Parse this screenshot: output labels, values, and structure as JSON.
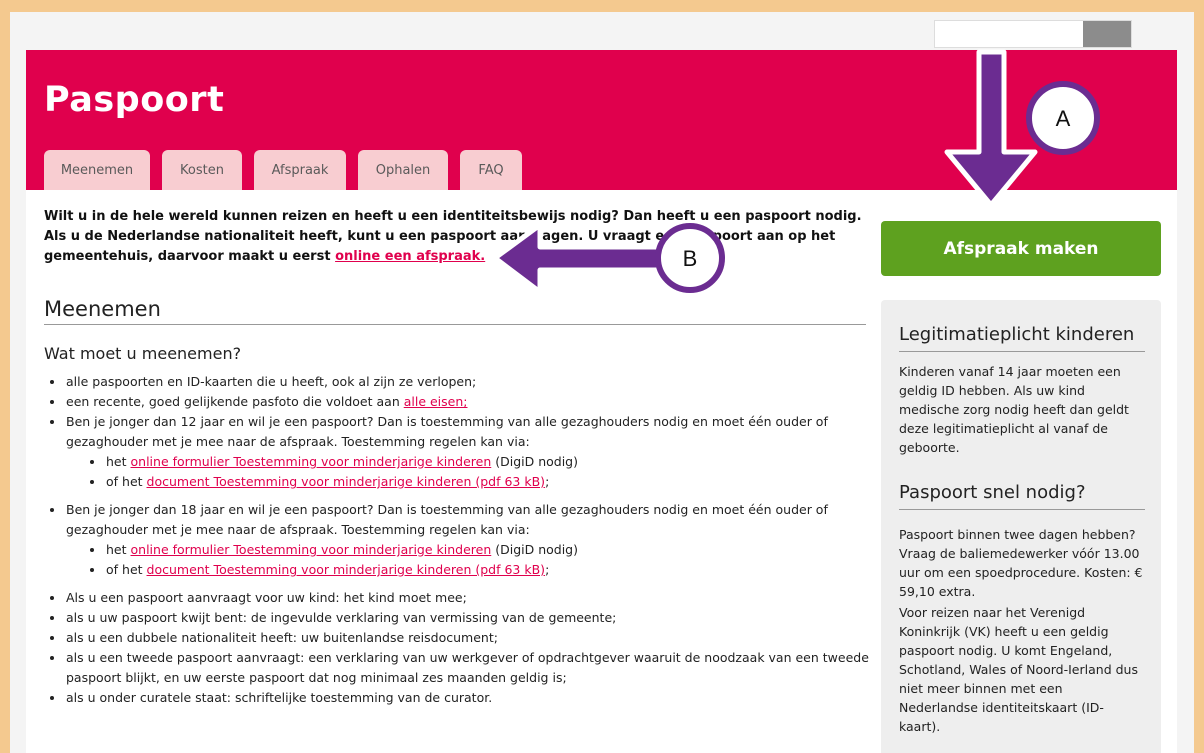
{
  "page": {
    "title": "Paspoort"
  },
  "tabs": [
    "Meenemen",
    "Kosten",
    "Afspraak",
    "Ophalen",
    "FAQ"
  ],
  "intro": {
    "line1": "Wilt u in de hele wereld kunnen reizen en heeft u een identiteitsbewijs nodig? Dan heeft u een paspoort nodig.",
    "line2": "Als u de Nederlandse nationaliteit heeft, kunt u een paspoort aanvragen. U vraagt een paspoort aan op het",
    "line3_prefix": "gemeentehuis, daarvoor maakt u eerst ",
    "line3_link": "online een afspraak."
  },
  "section": {
    "heading": "Meenemen",
    "subheading": "Wat moet u meenemen?",
    "items": {
      "i1": "alle paspoorten en ID-kaarten die u heeft, ook al zijn ze verlopen;",
      "i2_text": "een recente, goed gelijkende pasfoto die voldoet aan ",
      "i2_link": "alle eisen;",
      "i3": "Ben je jonger dan 12 jaar en wil je een paspoort? Dan is toestemming van alle gezaghouders nodig en moet één ouder of gezaghouder met je mee naar de afspraak. Toestemming regelen kan via:",
      "i3a_pre": "het ",
      "i3a_link": "online formulier Toestemming voor minderjarige kinderen",
      "i3a_post": " (DigiD nodig)",
      "i3b_pre": "of het ",
      "i3b_link": "document Toestemming voor minderjarige kinderen (pdf 63 kB)",
      "i3b_post": ";",
      "i4": "Ben je jonger dan 18 jaar en wil je een paspoort? Dan is toestemming van alle gezaghouders nodig en moet één ouder of gezaghouder met je mee naar de afspraak. Toestemming regelen kan via:",
      "i4a_pre": "het ",
      "i4a_link": "online formulier Toestemming voor minderjarige kinderen",
      "i4a_post": " (DigiD nodig)",
      "i4b_pre": "of het ",
      "i4b_link": "document Toestemming voor minderjarige kinderen (pdf 63 kB)",
      "i4b_post": ";",
      "i5": "Als u een paspoort aanvraagt voor uw kind: het kind moet mee;",
      "i6": "als u uw paspoort kwijt bent: de ingevulde verklaring van vermissing van de gemeente;",
      "i7": "als u een dubbele nationaliteit heeft: uw buitenlandse reisdocument;",
      "i8": "als u een tweede paspoort aanvraagt: een verklaring van uw werkgever of opdrachtgever waaruit de noodzaak van een tweede paspoort blijkt, en uw eerste paspoort dat nog minimaal zes maanden geldig is;",
      "i9": "als u onder curatele staat: schriftelijke toestemming van de curator."
    }
  },
  "cta": {
    "label": "Afspraak maken"
  },
  "sidebar": {
    "h1": "Legitimatieplicht kinderen",
    "p1": "Kinderen vanaf 14 jaar moeten een geldig ID hebben. Als uw kind medische zorg nodig heeft dan geldt deze legitimatieplicht al vanaf de geboorte.",
    "h2": "Paspoort snel nodig?",
    "p2": "Paspoort binnen twee dagen hebben? Vraag de baliemedewerker vóór 13.00 uur om een spoedprocedure. Kosten: € 59,10 extra.",
    "p3": "Voor reizen naar het Verenigd Koninkrijk (VK) heeft u een geldig paspoort nodig. U komt Engeland, Schotland, Wales of Noord-Ierland dus niet meer binnen met een Nederlandse identiteitskaart (ID-kaart)."
  },
  "annotations": {
    "a": "A",
    "b": "B",
    "color": "#6b2c91"
  },
  "colors": {
    "brand": "#e0004d",
    "tab": "#f8cdd1",
    "cta": "#5ea11f",
    "frame": "#f4c98f"
  }
}
